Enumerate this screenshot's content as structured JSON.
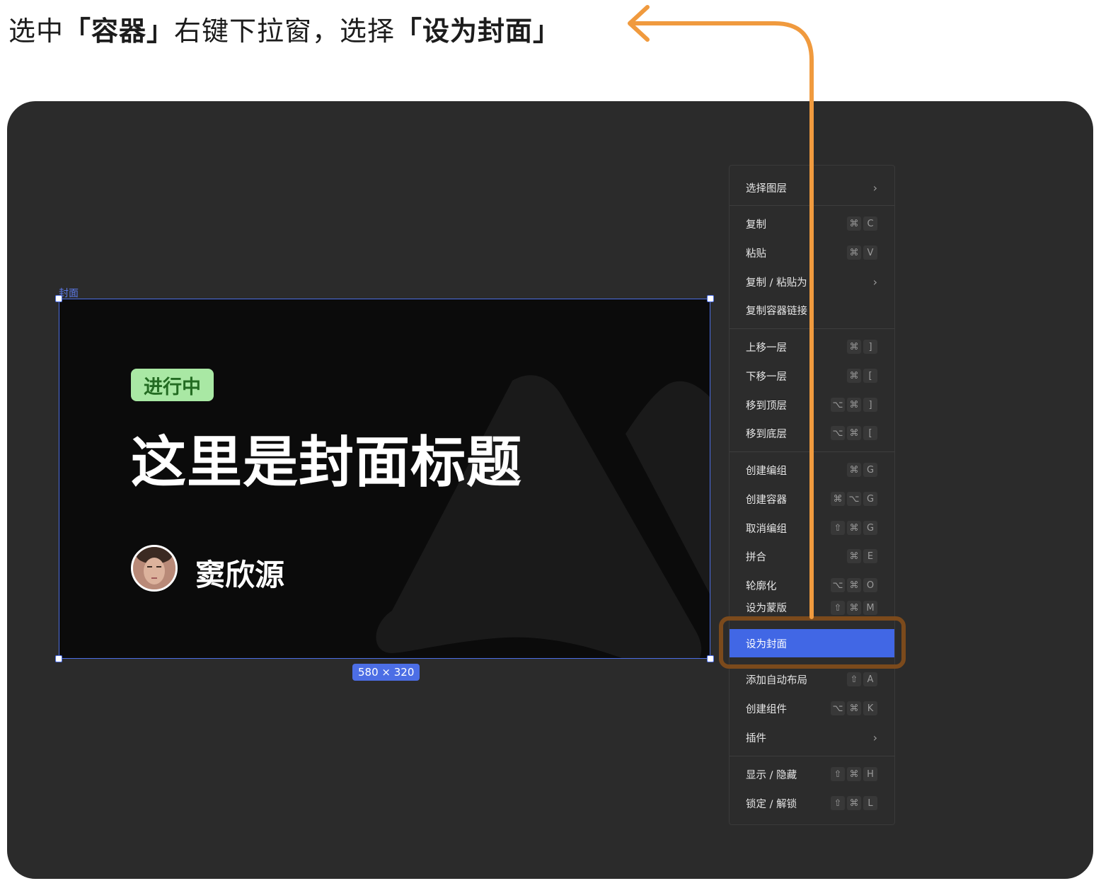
{
  "instruction": {
    "part1": "选中",
    "part2": "「容器」",
    "part3": "右键下拉窗，选择",
    "part4": "「设为封面」"
  },
  "frame": {
    "label": "封面",
    "size_label": "580 × 320",
    "status_badge": "进行中",
    "title": "这里是封面标题",
    "author": "窦欣源"
  },
  "colors": {
    "selection": "#4c6ee5",
    "menu_active": "#4167e5",
    "arrow": "#f09a3e",
    "highlight": "#7b4a1c",
    "badge_bg": "#a9e8a4",
    "badge_text": "#236b22"
  },
  "menu": {
    "select_layer": "选择图层",
    "copy": "复制",
    "copy_keys": [
      "⌘",
      "C"
    ],
    "paste": "粘贴",
    "paste_keys": [
      "⌘",
      "V"
    ],
    "copy_paste_as": "复制 / 粘贴为",
    "copy_container_link": "复制容器链接",
    "move_up": "上移一层",
    "move_up_keys": [
      "⌘",
      "]"
    ],
    "move_down": "下移一层",
    "move_down_keys": [
      "⌘",
      "["
    ],
    "move_top": "移到顶层",
    "move_top_keys": [
      "⌥",
      "⌘",
      "]"
    ],
    "move_bottom": "移到底层",
    "move_bottom_keys": [
      "⌥",
      "⌘",
      "["
    ],
    "create_group": "创建编组",
    "create_group_keys": [
      "⌘",
      "G"
    ],
    "create_container": "创建容器",
    "create_container_keys": [
      "⌘",
      "⌥",
      "G"
    ],
    "ungroup": "取消编组",
    "ungroup_keys": [
      "⇧",
      "⌘",
      "G"
    ],
    "merge": "拼合",
    "merge_keys": [
      "⌘",
      "E"
    ],
    "outline": "轮廓化",
    "outline_keys": [
      "⌥",
      "⌘",
      "O"
    ],
    "set_mask": "设为蒙版",
    "set_mask_keys": [
      "⇧",
      "⌘",
      "M"
    ],
    "set_cover": "设为封面",
    "add_auto_layout": "添加自动布局",
    "add_auto_layout_keys": [
      "⇧",
      "A"
    ],
    "create_component": "创建组件",
    "create_component_keys": [
      "⌥",
      "⌘",
      "K"
    ],
    "plugins": "插件",
    "show_hide": "显示 / 隐藏",
    "show_hide_keys": [
      "⇧",
      "⌘",
      "H"
    ],
    "lock_unlock": "锁定 / 解锁",
    "lock_unlock_keys": [
      "⇧",
      "⌘",
      "L"
    ],
    "chevron": "›"
  }
}
